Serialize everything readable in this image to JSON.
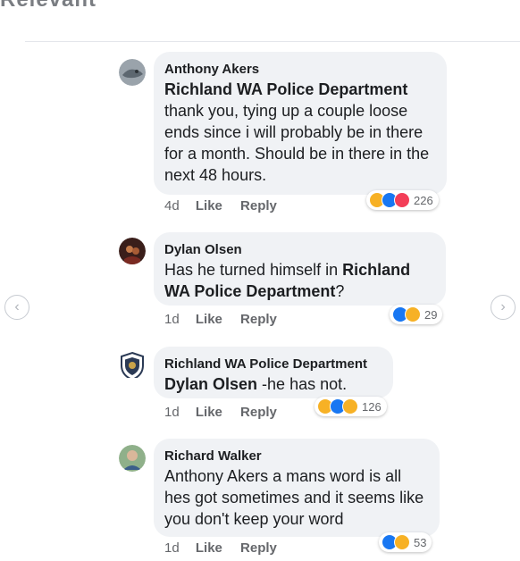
{
  "top_fragment": "Relevant",
  "comments": [
    {
      "author": "Anthony Akers",
      "mention": "Richland WA Police Department",
      "text": "thank you, tying up a couple loose ends since i will probably be in there for a month. Should be in there in the next 48 hours.",
      "time": "4d",
      "like_label": "Like",
      "reply_label": "Reply",
      "reaction_count": "226",
      "reactions": [
        "haha",
        "like",
        "love"
      ]
    },
    {
      "author": "Dylan Olsen",
      "text_prefix": "Has he turned himself in ",
      "mention": "Richland WA Police Department",
      "text_suffix": "?",
      "time": "1d",
      "like_label": "Like",
      "reply_label": "Reply",
      "reaction_count": "29",
      "reactions": [
        "like",
        "haha"
      ]
    },
    {
      "author": "Richland WA Police Department",
      "mention": "Dylan Olsen",
      "text": " -he has not.",
      "time": "1d",
      "like_label": "Like",
      "reply_label": "Reply",
      "reaction_count": "126",
      "reactions": [
        "haha",
        "like",
        "wow"
      ]
    },
    {
      "author": "Richard Walker",
      "text": "Anthony Akers a mans word is all hes got sometimes and it seems like you don't keep your word",
      "time": "1d",
      "like_label": "Like",
      "reply_label": "Reply",
      "reaction_count": "53",
      "reactions": [
        "like",
        "haha"
      ]
    }
  ],
  "nav": {
    "prev_glyph": "‹",
    "next_glyph": "›"
  }
}
